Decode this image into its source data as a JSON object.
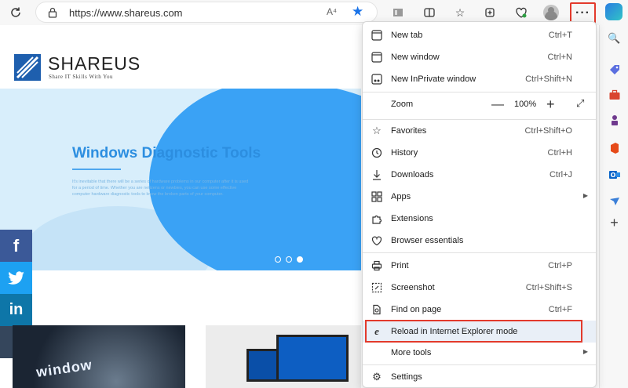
{
  "browser": {
    "url": "https://www.shareus.com",
    "read_aloud": "A⁴"
  },
  "menu": {
    "items": [
      {
        "label": "New tab",
        "shortcut": "Ctrl+T"
      },
      {
        "label": "New window",
        "shortcut": "Ctrl+N"
      },
      {
        "label": "New InPrivate window",
        "shortcut": "Ctrl+Shift+N"
      },
      {
        "label": "Zoom",
        "shortcut": ""
      },
      {
        "label": "Favorites",
        "shortcut": "Ctrl+Shift+O"
      },
      {
        "label": "History",
        "shortcut": "Ctrl+H"
      },
      {
        "label": "Downloads",
        "shortcut": "Ctrl+J"
      },
      {
        "label": "Apps",
        "shortcut": ""
      },
      {
        "label": "Extensions",
        "shortcut": ""
      },
      {
        "label": "Browser essentials",
        "shortcut": ""
      },
      {
        "label": "Print",
        "shortcut": "Ctrl+P"
      },
      {
        "label": "Screenshot",
        "shortcut": "Ctrl+Shift+S"
      },
      {
        "label": "Find on page",
        "shortcut": "Ctrl+F"
      },
      {
        "label": "Reload in Internet Explorer mode",
        "shortcut": ""
      },
      {
        "label": "More tools",
        "shortcut": ""
      },
      {
        "label": "Settings",
        "shortcut": ""
      }
    ],
    "zoom_value": "100%"
  },
  "site": {
    "logo_name": "SHAREUS",
    "logo_tagline": "Share IT Skills With You",
    "banner_title": "Windows Diagnostic Tools",
    "banner_text": "It's inevitable that there will be a series of hardware problems in our computer after it is used for a period of time. Whether you are netizens or newbies, you can use some effective computer hardware diagnostic tools to know the broken parts of your computer.",
    "social": [
      "f",
      "t",
      "in",
      "t"
    ],
    "thumb_word": "window"
  },
  "colors": {
    "accent": "#1a73e8",
    "highlight_border": "#e33a2c",
    "banner_blue": "#3aa2f5"
  }
}
